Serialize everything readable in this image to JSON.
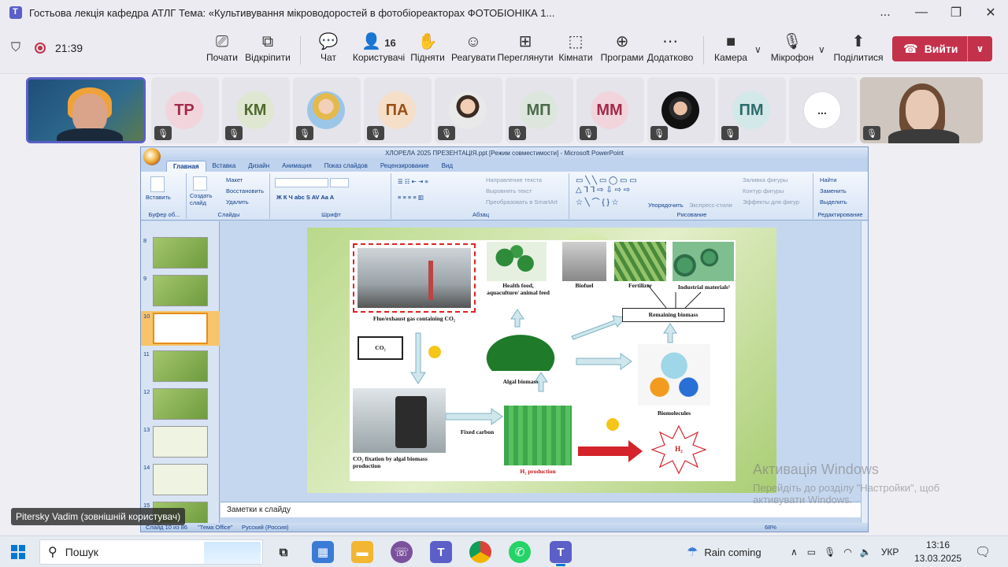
{
  "window": {
    "title": "Гостьова лекція кафедра АТЛГ Тема: «Культивування мікроводоростей в фотобіореакторах ФОТОБІОНІКА 1...",
    "controls": [
      "...",
      "—",
      "❐",
      "✕"
    ]
  },
  "toolbar": {
    "timer": "21:39",
    "buttons": {
      "start": "Почати",
      "unpin": "Відкріпити",
      "chat": "Чат",
      "people": "Користувачі",
      "people_count": "16",
      "raise": "Підняти",
      "react": "Реагувати",
      "view": "Переглянути",
      "rooms": "Кімнати",
      "apps": "Програми",
      "more": "Додатково",
      "camera": "Камера",
      "mic": "Мікрофон",
      "share": "Поділитися"
    },
    "leave_label": "Вийти"
  },
  "participants": [
    {
      "initials": "ТР",
      "color": "#f2d5dc",
      "text": "#a12b4c"
    },
    {
      "initials": "КМ",
      "color": "#dfe7d3",
      "text": "#4f6a2e"
    },
    {
      "initials": "ПА",
      "color": "#f5dfc9",
      "text": "#9a4f16"
    },
    {
      "initials": "МП",
      "color": "#dde6dc",
      "text": "#4c6a4a"
    },
    {
      "initials": "ММ",
      "color": "#f2d5dc",
      "text": "#a12b4c"
    },
    {
      "initials": "ПМ",
      "color": "#d3e8e8",
      "text": "#2d6c6c"
    },
    {
      "initials": "..."
    }
  ],
  "ppt": {
    "title": "ХЛОРЕЛА 2025 ПРЕЗЕНТАЦІЯ.ppt [Режим совместимости] - Microsoft PowerPoint",
    "tabs": [
      "Главная",
      "Вставка",
      "Дизайн",
      "Анимация",
      "Показ слайдов",
      "Рецензирование",
      "Вид"
    ],
    "groups": {
      "clipboard": "Буфер об...",
      "paste": "Вставить",
      "slides": "Слайды",
      "new_slide": "Создать слайд",
      "layout": "Макет",
      "reset": "Восстановить",
      "delete": "Удалить",
      "font": "Шрифт",
      "paragraph": "Абзац",
      "text_direction": "Направление текста",
      "align_text": "Выровнять текст",
      "smartart": "Преобразовать в SmartArt",
      "drawing": "Рисование",
      "arrange": "Упорядочить",
      "quick_styles": "Экспресс-стили",
      "shape_fill": "Заливка фигуры",
      "shape_outline": "Контур фигуры",
      "shape_effects": "Эффекты для фигур",
      "editing": "Редактирование",
      "find": "Найти",
      "replace": "Заменить",
      "select": "Выделить"
    },
    "thumbs": [
      "8",
      "9",
      "10",
      "11",
      "12",
      "13",
      "14",
      "15"
    ],
    "notes": "Заметки к слайду",
    "status": {
      "slide": "Слайд 10 из 86",
      "theme": "\"Тема Office\"",
      "lang": "Русский (Россия)",
      "zoom": "68%"
    }
  },
  "figure": {
    "flue": "Flue/exhaust gas containing CO₂",
    "health": "Health food, aquaculture/ animal feed",
    "biofuel": "Biofuel",
    "fertilizer": "Fertilizer",
    "industrial": "Industrial materials¹",
    "remaining": "Remaining biomass",
    "co2": "CO₂",
    "algal": "Algal biomass",
    "biomolecules": "Biomolecules",
    "fixed": "Fixed carbon",
    "fixation": "CO₂ fixation by algal biomass production",
    "h2prod": "H₂ production",
    "h2": "H₂"
  },
  "watermark": {
    "line1": "Активація Windows",
    "line2": "Перейдіть до розділу \"Настройки\", щоб",
    "line3": "активувати Windows."
  },
  "name_tag": "Pitersky Vadim (зовнішній користувач)",
  "taskbar": {
    "search": "Пошук",
    "weather": "Rain coming",
    "lang": "УКР",
    "time": "13:16",
    "date": "13.03.2025"
  }
}
